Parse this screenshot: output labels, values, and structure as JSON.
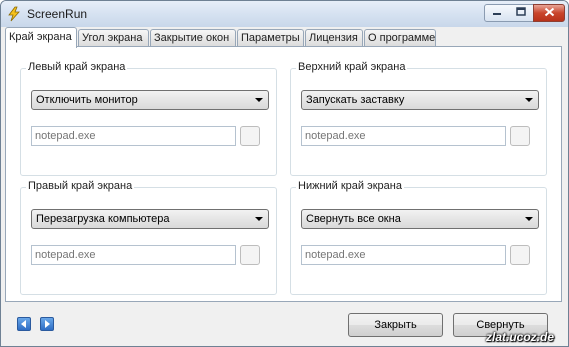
{
  "window": {
    "title": "ScreenRun"
  },
  "tabs": [
    {
      "label": "Край экрана",
      "active": true
    },
    {
      "label": "Угол экрана",
      "active": false
    },
    {
      "label": "Закрытие окон",
      "active": false
    },
    {
      "label": "Параметры",
      "active": false
    },
    {
      "label": "Лицензия",
      "active": false
    },
    {
      "label": "О программе",
      "active": false
    }
  ],
  "groups": {
    "left": {
      "label": "Левый край экрана",
      "action": "Отключить монитор",
      "program_placeholder": "notepad.exe"
    },
    "top": {
      "label": "Верхний край экрана",
      "action": "Запускать заставку",
      "program_placeholder": "notepad.exe"
    },
    "right": {
      "label": "Правый край экрана",
      "action": "Перезагрузка компьютера",
      "program_placeholder": "notepad.exe"
    },
    "bottom": {
      "label": "Нижний край экрана",
      "action": "Свернуть все окна",
      "program_placeholder": "notepad.exe"
    }
  },
  "buttons": {
    "close": "Закрыть",
    "minimize": "Свернуть"
  },
  "watermark": "zlat.ucoz.de",
  "colors": {
    "close_button": "#c9452c",
    "nav_blue": "#2e6dc4",
    "panel_border": "#98a7b8"
  }
}
